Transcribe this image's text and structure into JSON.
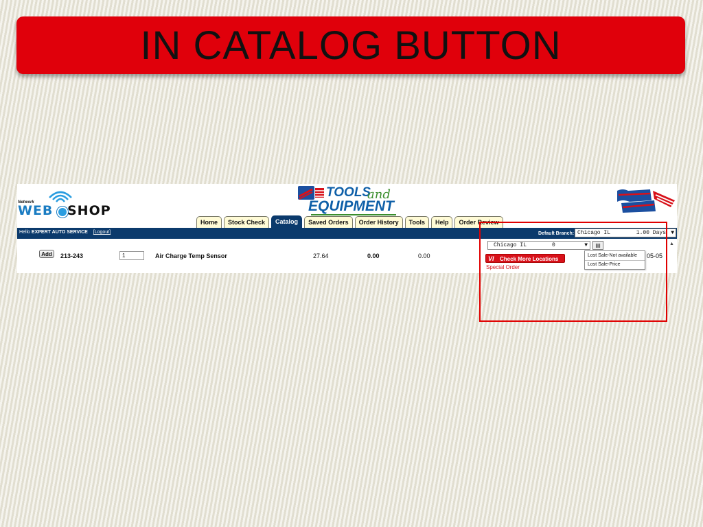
{
  "slide": {
    "title": "IN CATALOG BUTTON"
  },
  "header": {
    "network_label": "Network",
    "web_label": "WEB",
    "shop_label": "SHOP",
    "tools_badge": "AUTO PRIDE",
    "tools_line1": "TOOLS",
    "tools_and": "and",
    "tools_line2": "EQUIPMENT",
    "autopride_logo": "AUTO PRIDE"
  },
  "tabs": [
    "Home",
    "Stock Check",
    "Catalog",
    "Saved Orders",
    "Order History",
    "Tools",
    "Help",
    "Order Review"
  ],
  "active_tab": "Catalog",
  "navbar": {
    "hello": "Hello",
    "user": "EXPERT AUTO SERVICE",
    "logout": "[Logout]",
    "default_branch_label": "Default Branch:",
    "branch_name": "Chicago IL",
    "branch_days": "1.00 Days"
  },
  "row": {
    "add_label": "Add",
    "part_no": "213-243",
    "qty": "1",
    "description": "Air Charge Temp Sensor",
    "price": "27.64",
    "core": "0.00",
    "total": "0.00",
    "location": "Chicago IL",
    "location_qty": "0",
    "check_vi": "VI",
    "check_label": "Check More Locations",
    "special_order": "Special Order",
    "date_fragment": "05-05"
  },
  "dropdown": {
    "items": [
      "Lost Sale-Not available",
      "Lost Sale-Price"
    ]
  },
  "colors": {
    "banner": "#e0000b",
    "navbar": "#0b3a6c",
    "tab_bg": "#fffbd6",
    "accent_red": "#d8111a",
    "highlight": "#e00000"
  },
  "icons": [
    "wifi-waves-icon",
    "dropdown-arrow-icon",
    "list-icon",
    "scroll-up-icon"
  ]
}
